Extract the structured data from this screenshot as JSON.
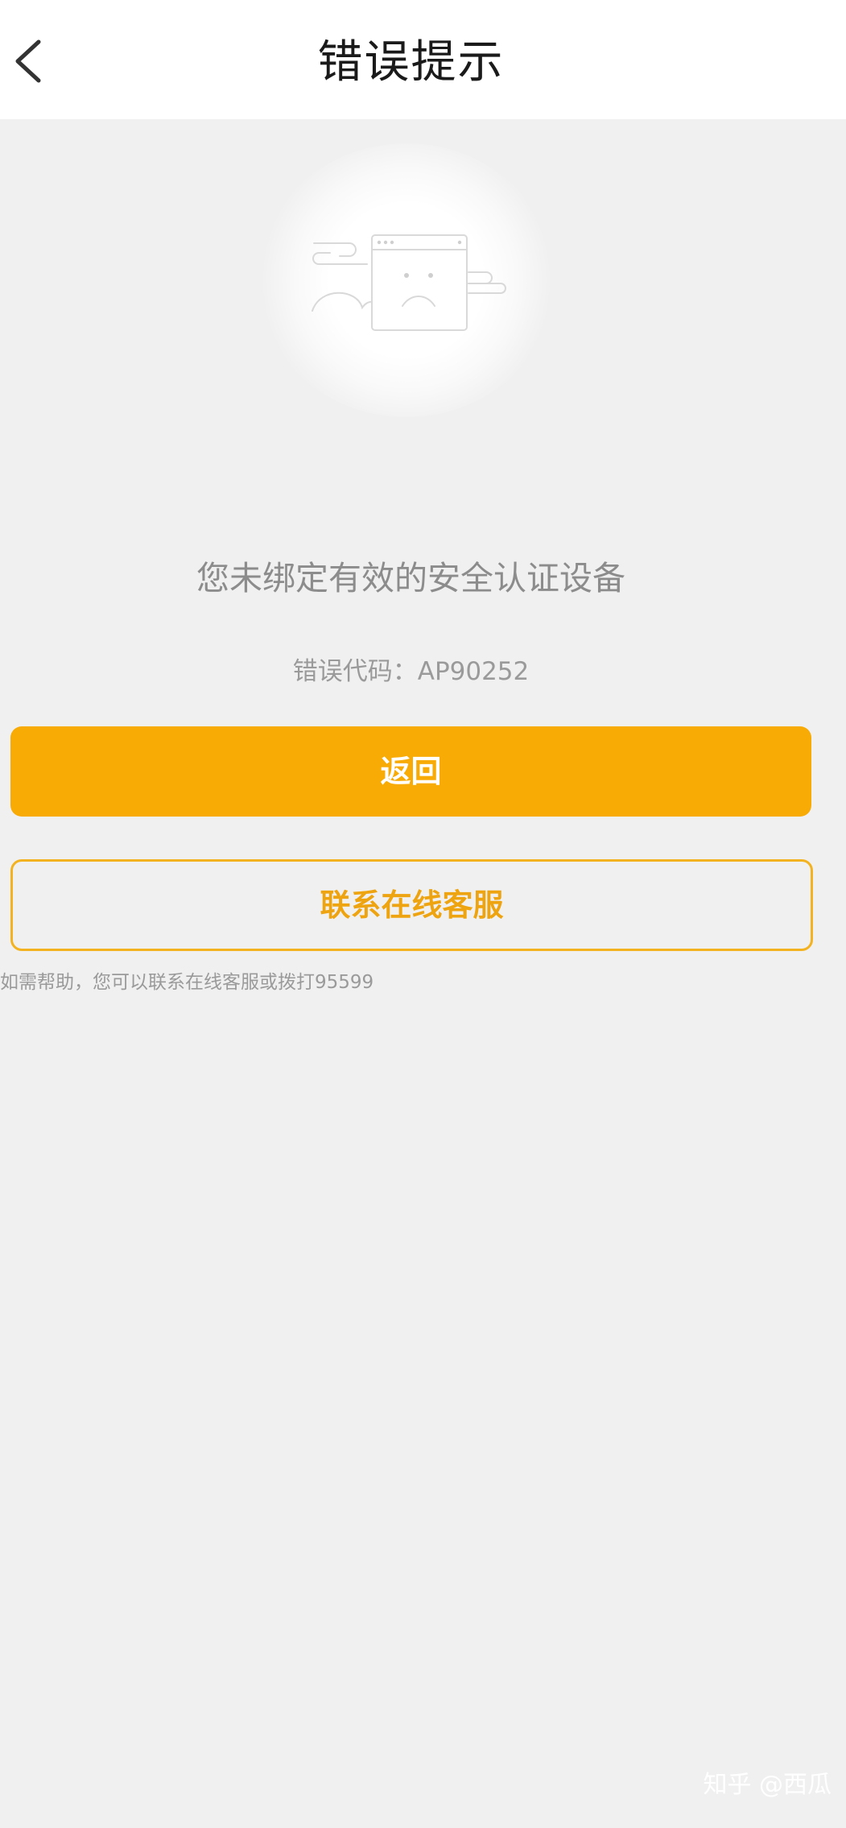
{
  "header": {
    "back_icon": "chevron-left-icon",
    "title": "错误提示"
  },
  "illustration": {
    "icon": "sad-browser-window-icon"
  },
  "message": "您未绑定有效的安全认证设备",
  "error": {
    "label": "错误代码：",
    "code": "AP90252"
  },
  "buttons": {
    "back_label": "返回",
    "contact_label": "联系在线客服"
  },
  "help": {
    "text": "如需帮助，您可以联系在线客服或拨打",
    "phone": "95599"
  },
  "watermark": "知乎 @西瓜",
  "colors": {
    "accent": "#f8aa05",
    "outline": "#f3b220",
    "background": "#f0f0f0",
    "header": "#ffffff",
    "muted_text": "#9a9a9a"
  }
}
